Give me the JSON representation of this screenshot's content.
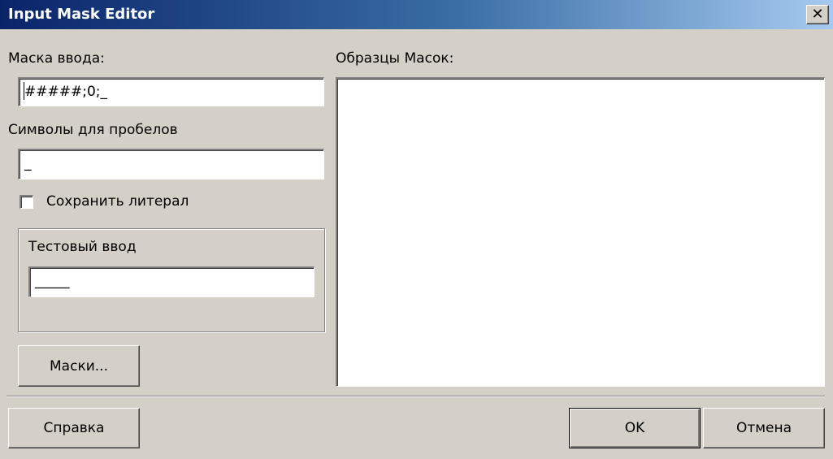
{
  "window": {
    "title": "Input Mask Editor",
    "close_glyph": "✕"
  },
  "mask_input": {
    "label": "Маска ввода:",
    "value": "#####;0;_"
  },
  "placeholder_chars": {
    "label": "Символы для пробелов",
    "value": "_"
  },
  "save_literal": {
    "label": "Сохранить литерал",
    "checked": false
  },
  "test_input": {
    "group_label": "Тестовый ввод",
    "value": "_____"
  },
  "masks_button": {
    "label": "Маски..."
  },
  "samples": {
    "label": "Образцы Масок:",
    "items": []
  },
  "footer": {
    "help_label": "Справка",
    "ok_label": "OK",
    "cancel_label": "Отмена"
  }
}
